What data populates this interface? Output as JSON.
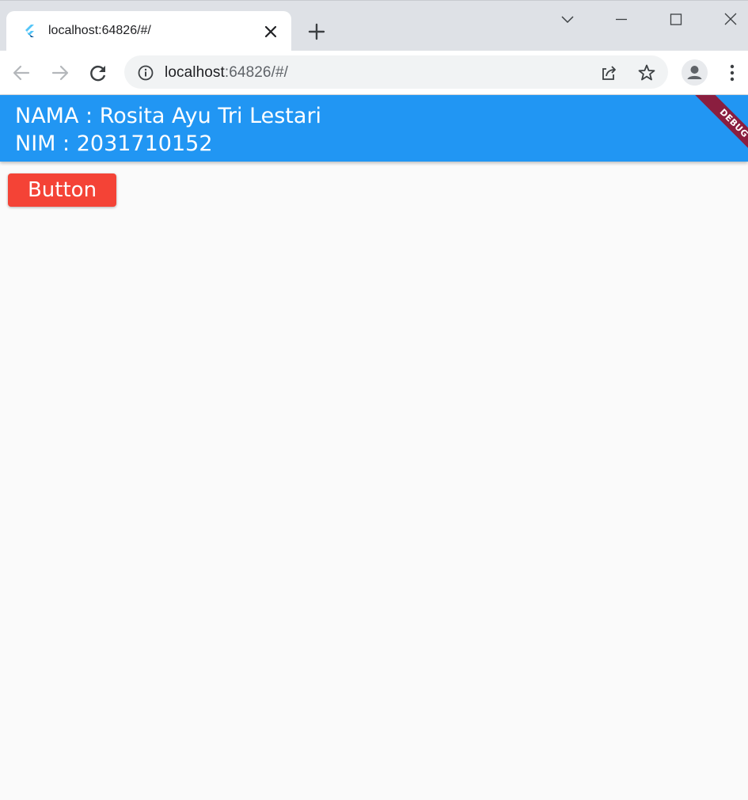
{
  "browser": {
    "tab": {
      "title": "localhost:64826/#/"
    },
    "address_bar": {
      "host": "localhost",
      "rest": ":64826/#/"
    }
  },
  "app": {
    "appbar": {
      "line1": "NAMA : Rosita Ayu Tri Lestari",
      "line2": "NIM : 2031710152",
      "background": "#2196F3"
    },
    "debug_banner": "DEBUG",
    "button": {
      "label": "Button",
      "color": "#F44336"
    }
  },
  "icons": {
    "tab_favicon": "flutter-icon",
    "tab_close": "close-icon",
    "new_tab": "plus-icon",
    "tab_search": "chevron-down-icon",
    "minimize": "minimize-icon",
    "maximize": "maximize-icon",
    "close_window": "close-icon",
    "back": "arrow-left-icon",
    "forward": "arrow-right-icon",
    "reload": "reload-icon",
    "site_info": "info-icon",
    "share": "share-icon",
    "bookmark": "star-icon",
    "profile": "avatar-icon",
    "menu": "more-vert-icon"
  }
}
